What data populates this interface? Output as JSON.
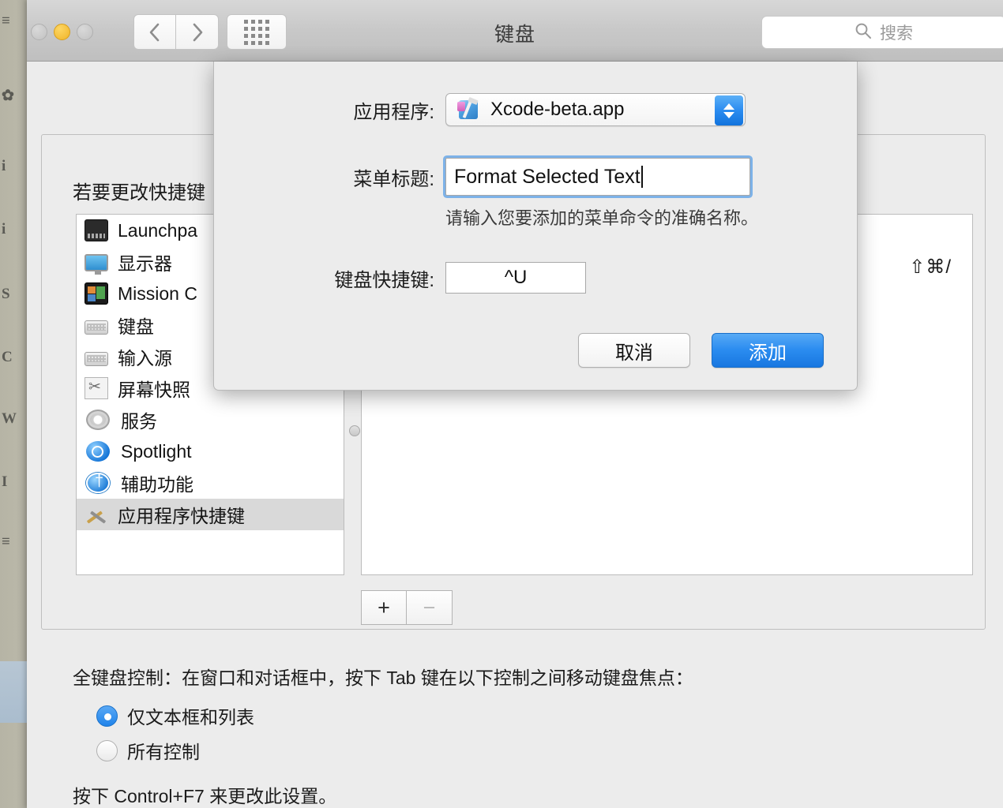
{
  "window": {
    "title": "键盘",
    "traffic_lights": [
      "close-button",
      "minimize-button",
      "zoom-button"
    ],
    "nav": {
      "back_icon": "chevron-left-icon",
      "forward_icon": "chevron-right-icon",
      "showall_icon": "grid-icon"
    },
    "search": {
      "placeholder": "搜索",
      "icon": "search-icon",
      "value": ""
    }
  },
  "main": {
    "instruction": "若要更改快捷键",
    "sidebar": {
      "items": [
        {
          "label": "Launchpa",
          "icon": "launchpad-icon",
          "selected": false
        },
        {
          "label": "显示器",
          "icon": "display-icon",
          "selected": false
        },
        {
          "label": "Mission C",
          "icon": "mission-control-icon",
          "selected": false
        },
        {
          "label": "键盘",
          "icon": "keyboard-icon",
          "selected": false
        },
        {
          "label": "输入源",
          "icon": "input-sources-icon",
          "selected": false
        },
        {
          "label": "屏幕快照",
          "icon": "screenshot-icon",
          "selected": false
        },
        {
          "label": "服务",
          "icon": "services-gear-icon",
          "selected": false
        },
        {
          "label": "Spotlight",
          "icon": "spotlight-icon",
          "selected": false
        },
        {
          "label": "辅助功能",
          "icon": "accessibility-icon",
          "selected": false
        },
        {
          "label": "应用程序快捷键",
          "icon": "app-shortcuts-icon",
          "selected": true
        }
      ]
    },
    "shortcut_table": {
      "key_display": "⇧⌘/"
    },
    "add_remove": {
      "add_label": "+",
      "remove_label": "−"
    },
    "full_keyboard_access": {
      "heading": "全键盘控制：在窗口和对话框中，按下 Tab 键在以下控制之间移动键盘焦点：",
      "options": [
        {
          "label": "仅文本框和列表",
          "selected": true
        },
        {
          "label": "所有控制",
          "selected": false
        }
      ],
      "footnote": "按下 Control+F7 来更改此设置。"
    }
  },
  "sheet": {
    "application": {
      "label": "应用程序:",
      "value": "Xcode-beta.app",
      "icon": "xcode-beta-app-icon"
    },
    "menu_title": {
      "label": "菜单标题:",
      "value": "Format Selected Text",
      "placeholder": ""
    },
    "menu_title_hint": "请输入您要添加的菜单命令的准确名称。",
    "shortcut": {
      "label": "键盘快捷键:",
      "value": "^U"
    },
    "buttons": {
      "cancel": "取消",
      "add": "添加"
    }
  },
  "colors": {
    "accent_blue": "#2b8cf0",
    "selection_gray": "#d9d9d9",
    "window_bg": "#ececec",
    "focus_ring": "#6aa8e7"
  }
}
